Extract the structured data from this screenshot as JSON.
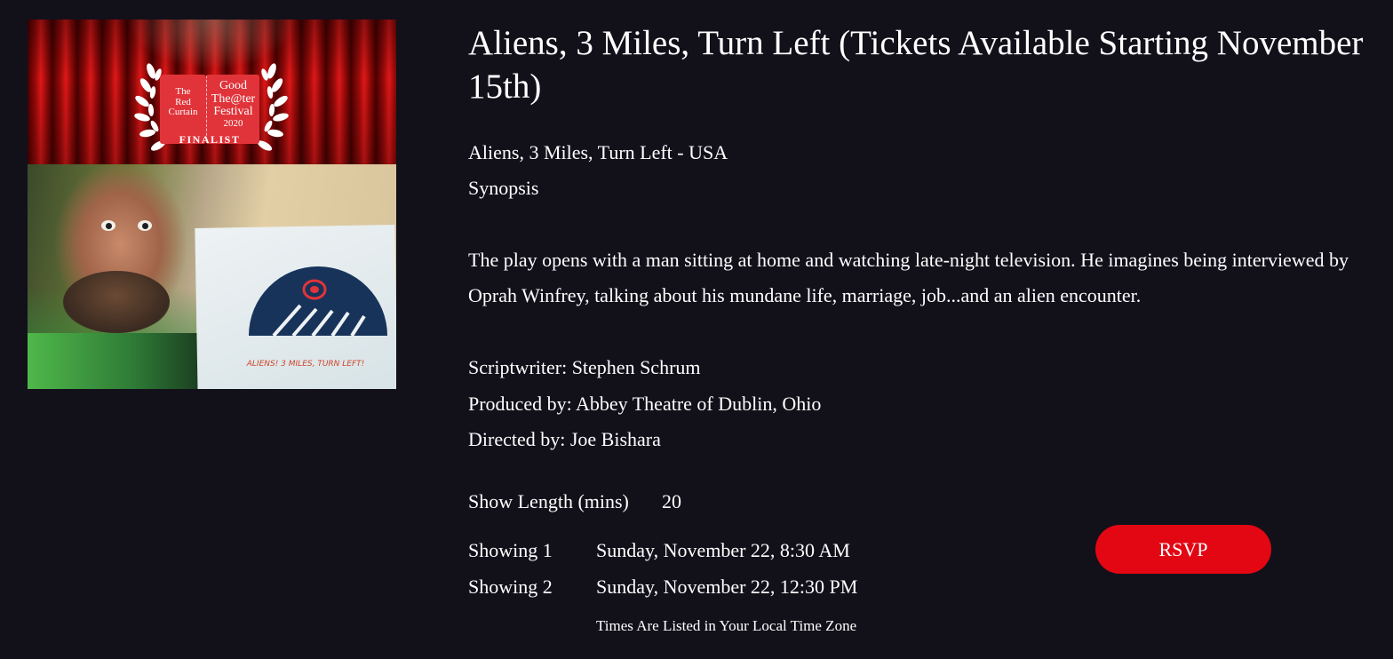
{
  "poster": {
    "alt": "Aliens, 3 Miles, Turn Left poster",
    "laurel": {
      "left_ticket": [
        "The",
        "Red",
        "Curtain"
      ],
      "right_ticket": [
        "Good",
        "The@ter",
        "Festival"
      ],
      "year": "2020",
      "badge": "FINALIST"
    },
    "paper_text": "ALIENS! 3 MILES, TURN LEFT!",
    "colors": {
      "curtain": "#c0121a",
      "ticket": "#e0343a",
      "sign": "#17335a",
      "sign_accent": "#e0343a"
    }
  },
  "show": {
    "title": "Aliens, 3 Miles, Turn Left (Tickets Available Starting November 15th)",
    "subtitle": "Aliens, 3 Miles, Turn Left - USA",
    "synopsis_heading": "Synopsis",
    "synopsis": "The play opens with a man sitting at home and watching late-night television. He imagines being interviewed by Oprah Winfrey, talking about his mundane life, marriage, job...and an alien encounter.",
    "scriptwriter": "Scriptwriter: Stephen Schrum",
    "producer": "Produced by: Abbey Theatre of Dublin, Ohio",
    "director": "Directed by: Joe Bishara",
    "length_label": "Show Length (mins)",
    "length_value": "20",
    "showings": [
      {
        "label": "Showing 1",
        "time": "Sunday, November 22, 8:30 AM"
      },
      {
        "label": "Showing 2",
        "time": "Sunday, November 22, 12:30 PM"
      }
    ],
    "timezone_note": "Times Are Listed in Your Local Time Zone",
    "rsvp_label": "RSVP"
  },
  "colors": {
    "background": "#12111a",
    "text": "#ffffff",
    "rsvp": "#e30613"
  }
}
